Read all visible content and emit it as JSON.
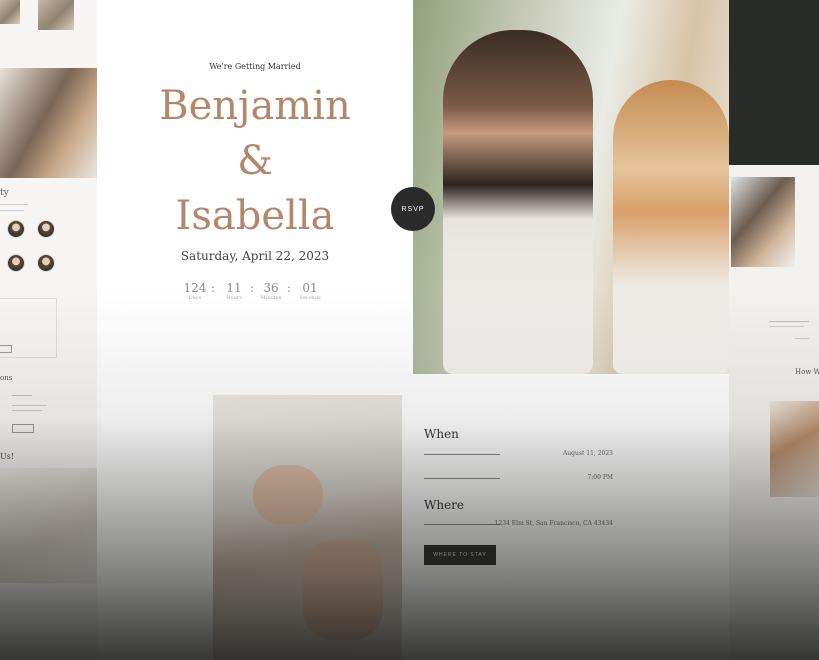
{
  "hero": {
    "tagline": "We're Getting Married",
    "name_1": "Benjamin",
    "ampersand": "&",
    "name_2": "Isabella",
    "date": "Saturday, April 22, 2023",
    "rsvp_label": "RSVP"
  },
  "countdown": [
    {
      "value": "124",
      "label": "Days"
    },
    {
      "value": "11",
      "label": "Hours"
    },
    {
      "value": "36",
      "label": "Minutes"
    },
    {
      "value": "01",
      "label": "Seconds"
    }
  ],
  "countdown_separator": ":",
  "details": {
    "when_heading": "When",
    "when_date": "August 11, 2023",
    "when_time": "7:00 PM",
    "where_heading": "Where",
    "where_address": "1234 Elm St, San Francisco, CA 43434",
    "button_label": "WHERE TO STAY"
  },
  "left_panel": {
    "heading_party": "ty",
    "heading_registry": "ons",
    "heading_join": "Us!"
  },
  "right_panel": {
    "heading": "How W"
  },
  "colors": {
    "accent_brown": "#b3876b",
    "button_dark": "#2f2f2f",
    "rsvp_circle": "#2b2b2b"
  }
}
